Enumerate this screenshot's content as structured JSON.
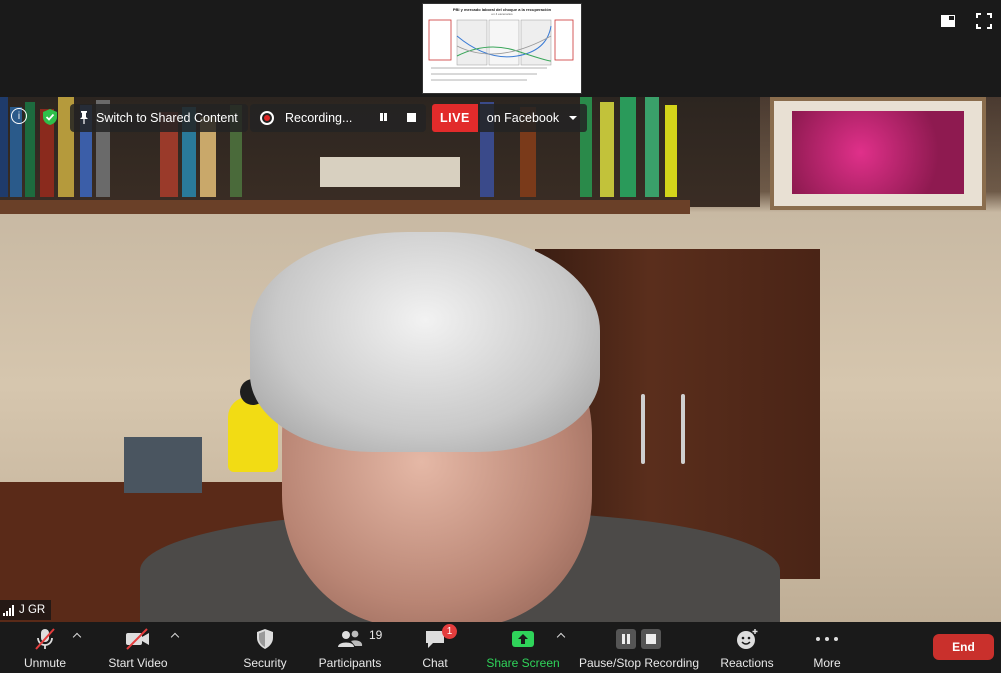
{
  "shared_thumbnail": {
    "title": "PBI y mercado laboral del choque a la recuperación",
    "subtitle": "en 4 escenarios"
  },
  "overlay": {
    "switch_label": "Switch to Shared Content",
    "recording_label": "Recording...",
    "live_badge": "LIVE",
    "live_target": "on Facebook"
  },
  "participant": {
    "name": "J GR"
  },
  "toolbar": {
    "unmute": "Unmute",
    "start_video": "Start Video",
    "security": "Security",
    "participants": "Participants",
    "participants_count": "19",
    "chat": "Chat",
    "chat_badge": "1",
    "share_screen": "Share Screen",
    "pause_stop_recording": "Pause/Stop Recording",
    "reactions": "Reactions",
    "more": "More",
    "end": "End"
  },
  "colors": {
    "accent_green": "#2fd45a",
    "live_red": "#e22b2b",
    "end_red": "#c9302c",
    "toolbar_bg": "#1a1a1a"
  }
}
